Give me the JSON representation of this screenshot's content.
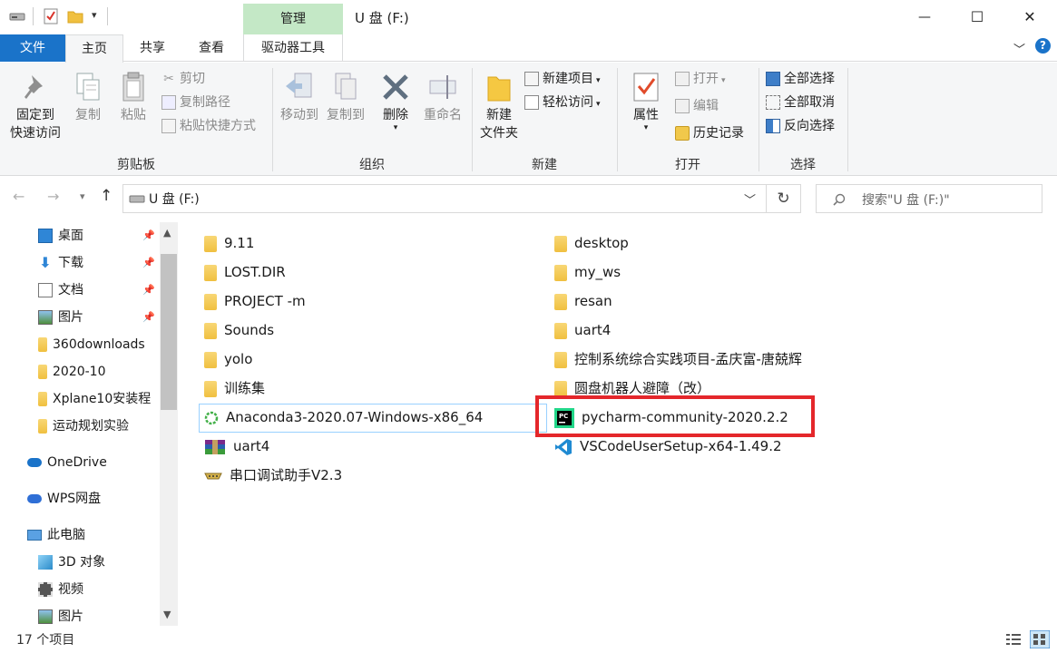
{
  "window": {
    "title": "U 盘 (F:)",
    "context_tab": "管理",
    "minimize_glyph": "—",
    "maximize_glyph": "☐",
    "close_glyph": "✕"
  },
  "tabs": {
    "file": "文件",
    "home": "主页",
    "share": "共享",
    "view": "查看",
    "drive_tools": "驱动器工具"
  },
  "ribbon": {
    "clipboard": {
      "label": "剪贴板",
      "pin_line1": "固定到",
      "pin_line2": "快速访问",
      "copy": "复制",
      "paste": "粘贴",
      "cut": "剪切",
      "copy_path": "复制路径",
      "paste_shortcut": "粘贴快捷方式"
    },
    "organize": {
      "label": "组织",
      "move_to": "移动到",
      "copy_to": "复制到",
      "delete": "删除",
      "rename": "重命名"
    },
    "new": {
      "label": "新建",
      "new_folder_line1": "新建",
      "new_folder_line2": "文件夹",
      "new_item": "新建项目",
      "easy_access": "轻松访问"
    },
    "open": {
      "label": "打开",
      "properties": "属性",
      "open": "打开",
      "edit": "编辑",
      "history": "历史记录"
    },
    "select": {
      "label": "选择",
      "select_all": "全部选择",
      "select_none": "全部取消",
      "invert": "反向选择"
    }
  },
  "address": {
    "path": "U 盘 (F:)",
    "search_placeholder": "搜索\"U 盘 (F:)\""
  },
  "nav": {
    "quick_access": [
      {
        "label": "桌面"
      },
      {
        "label": "下载"
      },
      {
        "label": "文档"
      },
      {
        "label": "图片"
      },
      {
        "label": "360downloads"
      },
      {
        "label": "2020-10"
      },
      {
        "label": "Xplane10安装程"
      },
      {
        "label": "运动规划实验"
      }
    ],
    "onedrive": "OneDrive",
    "wps": "WPS网盘",
    "this_pc": "此电脑",
    "objects3d": "3D 对象",
    "videos": "视频",
    "pictures": "图片"
  },
  "files": {
    "left": [
      {
        "name": "9.11",
        "type": "folder"
      },
      {
        "name": "LOST.DIR",
        "type": "folder"
      },
      {
        "name": "PROJECT -m",
        "type": "folder"
      },
      {
        "name": "Sounds",
        "type": "folder"
      },
      {
        "name": "yolo",
        "type": "folder"
      },
      {
        "name": "训练集",
        "type": "folder"
      },
      {
        "name": "Anaconda3-2020.07-Windows-x86_64",
        "type": "anaconda"
      },
      {
        "name": "uart4",
        "type": "winrar"
      },
      {
        "name": "串口调试助手V2.3",
        "type": "serial"
      }
    ],
    "right": [
      {
        "name": "desktop",
        "type": "folder"
      },
      {
        "name": "my_ws",
        "type": "folder"
      },
      {
        "name": "resan",
        "type": "folder"
      },
      {
        "name": "uart4",
        "type": "folder"
      },
      {
        "name": "控制系统综合实践项目-孟庆富-唐兢辉",
        "type": "folder"
      },
      {
        "name": "圆盘机器人避障（改）",
        "type": "folder"
      },
      {
        "name": "pycharm-community-2020.2.2",
        "type": "pycharm"
      },
      {
        "name": "VSCodeUserSetup-x64-1.49.2",
        "type": "vscode"
      }
    ]
  },
  "status": {
    "item_count": "17 个项目"
  },
  "colors": {
    "accent": "#1a73c9",
    "context_tab_bg": "#c4e8c6",
    "highlight_box": "#e4272b",
    "folder": "#f0c040"
  }
}
